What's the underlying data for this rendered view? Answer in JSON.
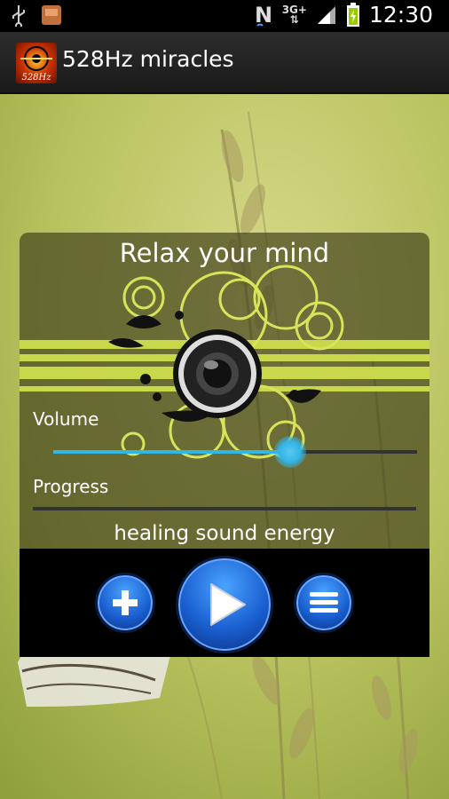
{
  "status_bar": {
    "time": "12:30",
    "network_label": "3G+",
    "icons": [
      "usb-icon",
      "sd-card-icon",
      "nfc-icon",
      "signal-icon",
      "battery-icon"
    ]
  },
  "action_bar": {
    "title": "528Hz miracles",
    "app_icon_label": "528Hz"
  },
  "player": {
    "title": "Relax your mind",
    "volume_label": "Volume",
    "volume_level": 0.65,
    "progress_label": "Progress",
    "progress_level": 0.0,
    "track_name": "healing sound energy"
  },
  "controls": {
    "buttons": [
      "add-button",
      "play-button",
      "menu-button"
    ]
  },
  "colors": {
    "accent": "#33b5e5",
    "button_blue": "#1a5fd0",
    "panel_overlay": "#46461e",
    "deco_green": "#c8d84a"
  }
}
